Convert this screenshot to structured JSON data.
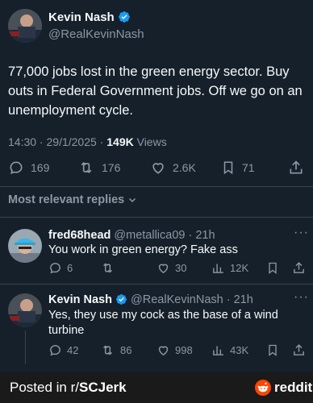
{
  "tweet": {
    "author_name": "Kevin Nash",
    "author_handle": "@RealKevinNash",
    "text": "77,000 jobs lost in the green energy sector. Buy outs in Federal Government jobs. Off we go on an unemployment cycle.",
    "time": "14:30",
    "date": "29/1/2025",
    "views_count": "149K",
    "views_label": "Views",
    "replies": "169",
    "retweets": "176",
    "likes": "2.6K",
    "bookmarks": "71"
  },
  "replies_filter": {
    "label": "Most relevant replies"
  },
  "reply1": {
    "name": "fred68head",
    "handle": "@metallica09",
    "time": "21h",
    "text": "You work in green energy? Fake ass",
    "replies": "6",
    "retweets": "",
    "likes": "30",
    "views": "12K"
  },
  "reply2": {
    "name": "Kevin Nash",
    "handle": "@RealKevinNash",
    "time": "21h",
    "text": "Yes, they use my cock as the base of a wind turbine",
    "replies": "42",
    "retweets": "86",
    "likes": "998",
    "views": "43K"
  },
  "footer": {
    "posted_in": "Posted in r/",
    "subreddit": "SCJerk",
    "brand": "reddit"
  },
  "colors": {
    "background": "#15202b",
    "footer": "#1a1a1b",
    "verified": "#1d9bf0",
    "muted": "#8b98a5",
    "reddit_orange": "#ff4500"
  }
}
